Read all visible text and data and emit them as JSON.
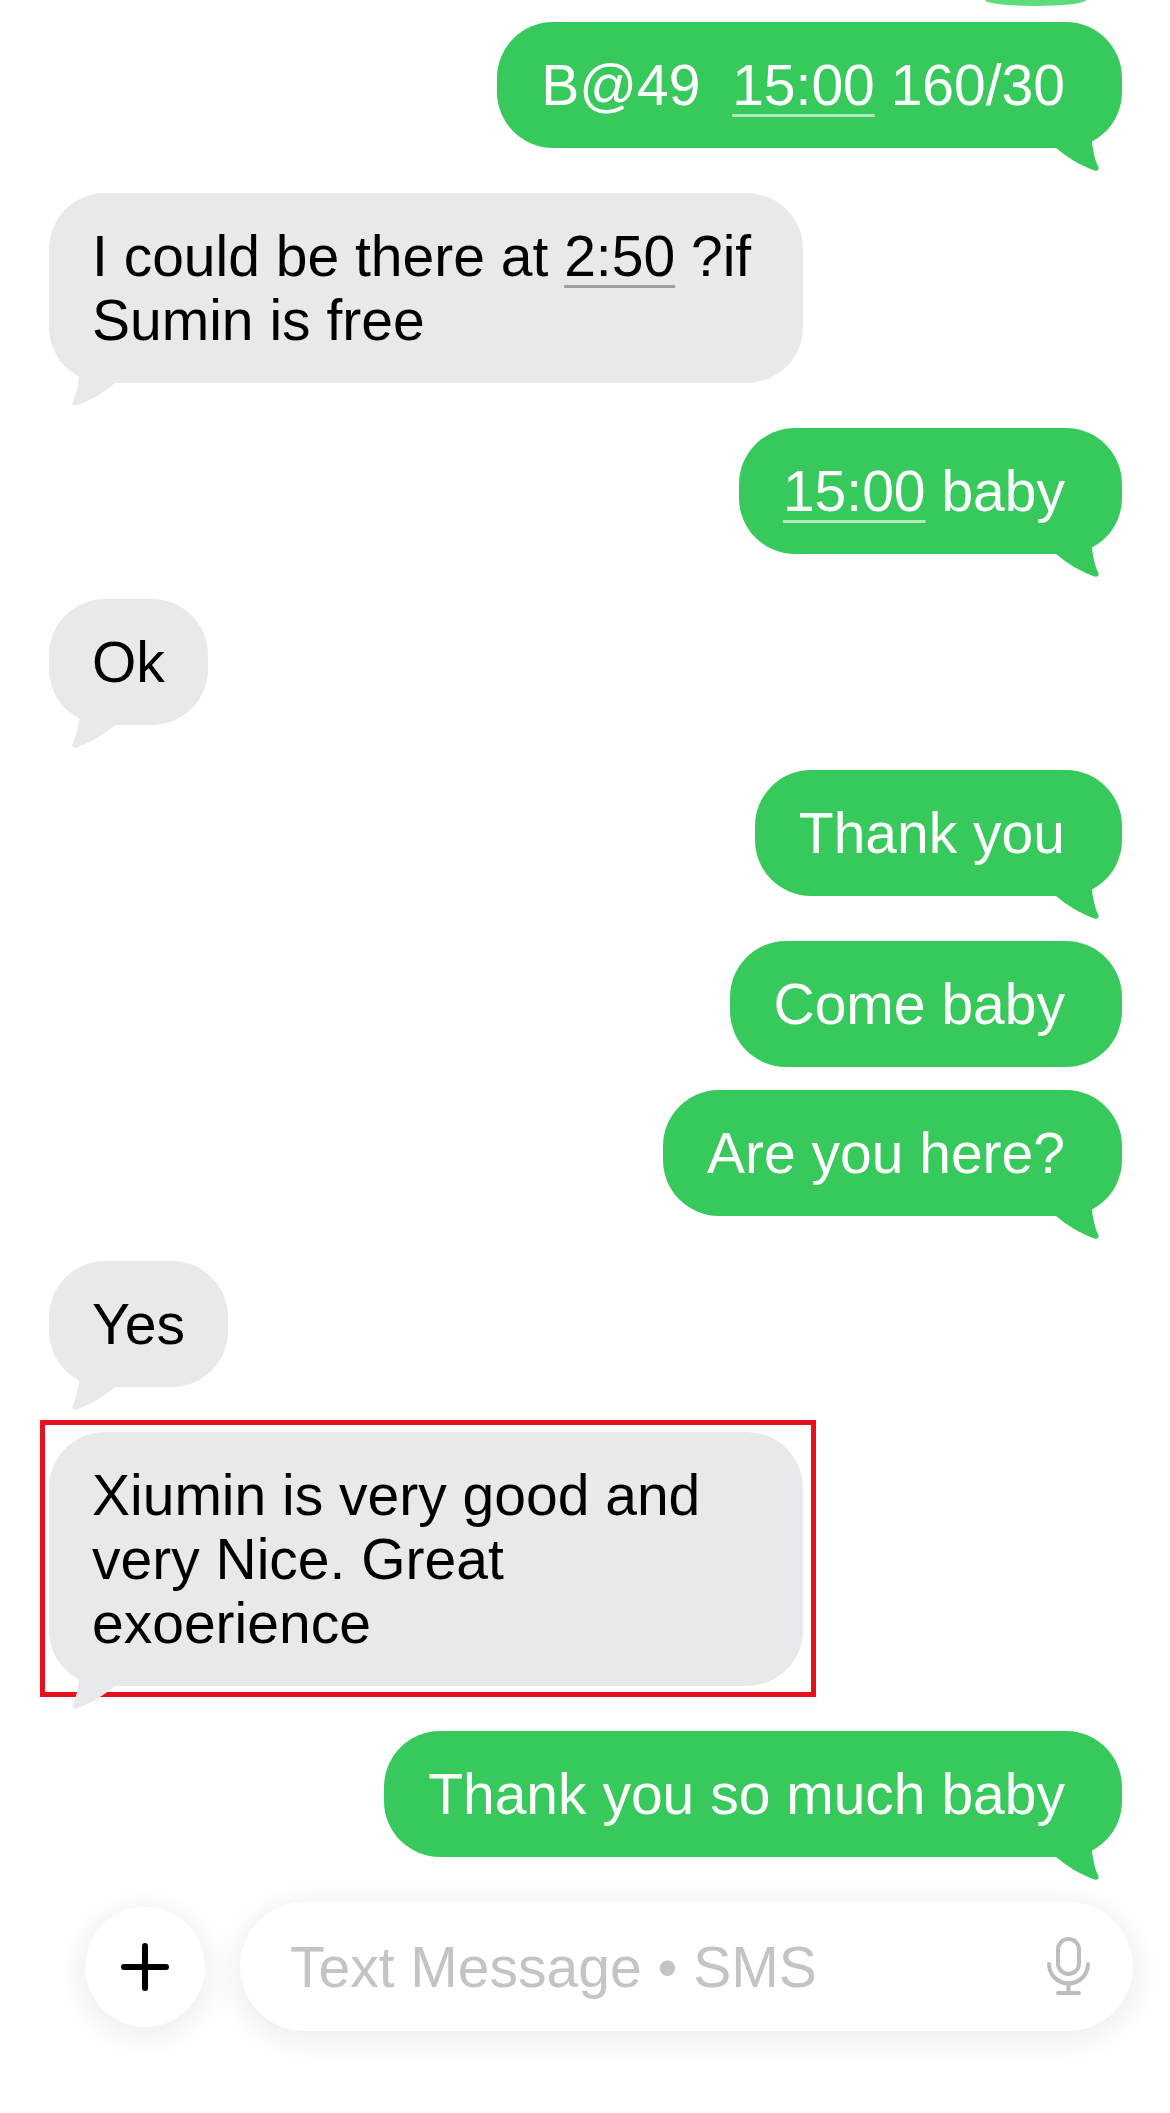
{
  "messages": [
    {
      "outgoing": true,
      "tail": true,
      "highlighted": false,
      "parts": [
        {
          "kind": "text",
          "text": "B@49  "
        },
        {
          "kind": "link",
          "text": "15:00"
        },
        {
          "kind": "text",
          "text": " 160/30"
        }
      ]
    },
    {
      "outgoing": false,
      "tail": true,
      "highlighted": false,
      "parts": [
        {
          "kind": "text",
          "text": "I could be there at "
        },
        {
          "kind": "link",
          "text": "2:50"
        },
        {
          "kind": "text",
          "text": " ?if Sumin is free"
        }
      ]
    },
    {
      "outgoing": true,
      "tail": true,
      "highlighted": false,
      "parts": [
        {
          "kind": "link",
          "text": "15:00"
        },
        {
          "kind": "text",
          "text": " baby"
        }
      ]
    },
    {
      "outgoing": false,
      "tail": true,
      "highlighted": false,
      "text": "Ok"
    },
    {
      "outgoing": true,
      "tail": true,
      "highlighted": false,
      "text": "Thank you"
    },
    {
      "outgoing": true,
      "tail": false,
      "highlighted": false,
      "text": "Come baby"
    },
    {
      "outgoing": true,
      "tail": true,
      "highlighted": false,
      "text": "Are you here?"
    },
    {
      "outgoing": false,
      "tail": true,
      "highlighted": false,
      "text": "Yes"
    },
    {
      "outgoing": false,
      "tail": true,
      "highlighted": true,
      "text": "Xiumin is very good and very Nice. Great exoerience"
    },
    {
      "outgoing": true,
      "tail": true,
      "highlighted": false,
      "text": "Thank you so much baby"
    }
  ],
  "composer": {
    "placeholder": "Text Message • SMS"
  }
}
